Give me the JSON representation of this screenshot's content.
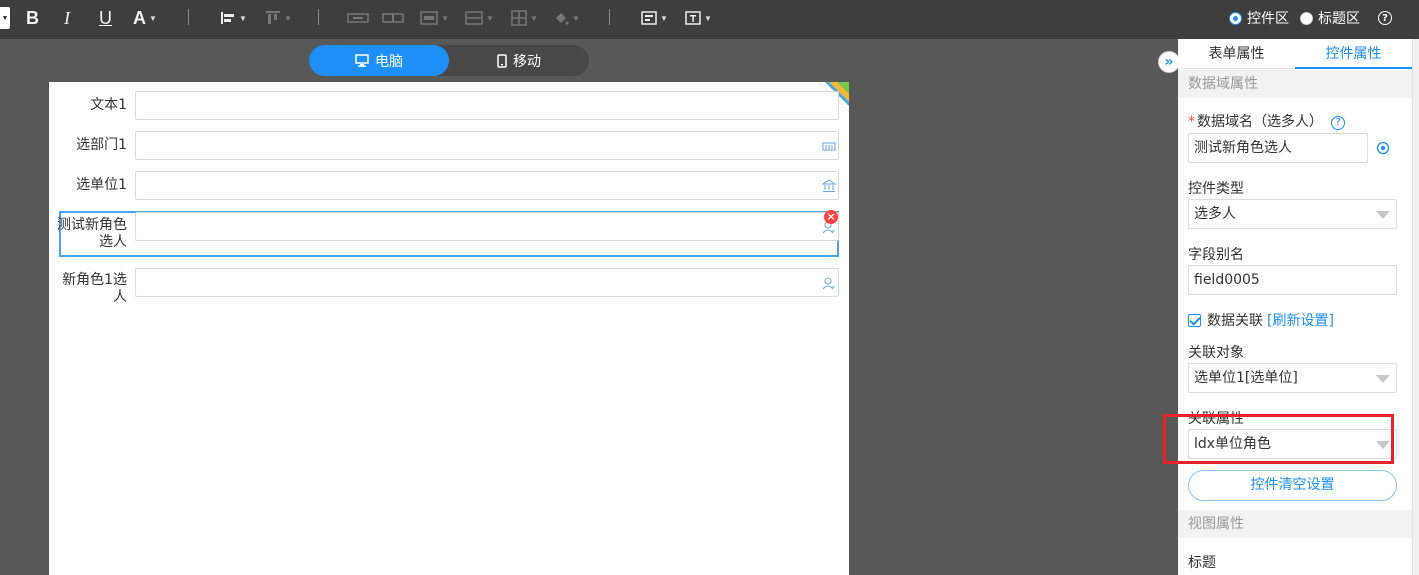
{
  "toolbar": {
    "bold": "B",
    "italic": "I",
    "underline": "U",
    "font_color": "A",
    "regions": [
      {
        "label": "控件区",
        "selected": true
      },
      {
        "label": "标题区",
        "selected": false
      }
    ],
    "help": "?"
  },
  "device_toggle": {
    "desktop_label": "电脑",
    "mobile_label": "移动",
    "active": "desktop"
  },
  "form": {
    "fields": [
      {
        "label": "文本1",
        "icon": "none"
      },
      {
        "label": "选部门1",
        "icon": "department-icon"
      },
      {
        "label": "选单位1",
        "icon": "building-icon"
      },
      {
        "label": "测试新角色选人",
        "icon": "person-icon",
        "selected": true
      },
      {
        "label": "新角色1选人",
        "icon": "person-icon"
      }
    ],
    "delete_badge": "×"
  },
  "panel": {
    "collapse_glyph": "»",
    "tabs": [
      "表单属性",
      "控件属性"
    ],
    "active_tab": "控件属性",
    "data_section": "数据域属性",
    "data_name_label": "数据域名（选多人）",
    "required_mark": "*",
    "data_name_value": "测试新角色选人",
    "control_type_label": "控件类型",
    "control_type_value": "选多人",
    "alias_label": "字段别名",
    "alias_value": "field0005",
    "data_link_label": "数据关联",
    "data_link_checked": true,
    "refresh_link": "[刷新设置]",
    "link_target_label": "关联对象",
    "link_target_value": "选单位1[选单位]",
    "link_attr_label": "关联属性",
    "link_attr_value": "ldx单位角色",
    "clear_button": "控件清空设置",
    "view_section": "视图属性",
    "title_label": "标题"
  },
  "colors": {
    "accent": "#1e8ff7",
    "highlight": "#e8232a",
    "toolbar_bg": "#3e3e3e",
    "workspace_bg": "#585858"
  }
}
